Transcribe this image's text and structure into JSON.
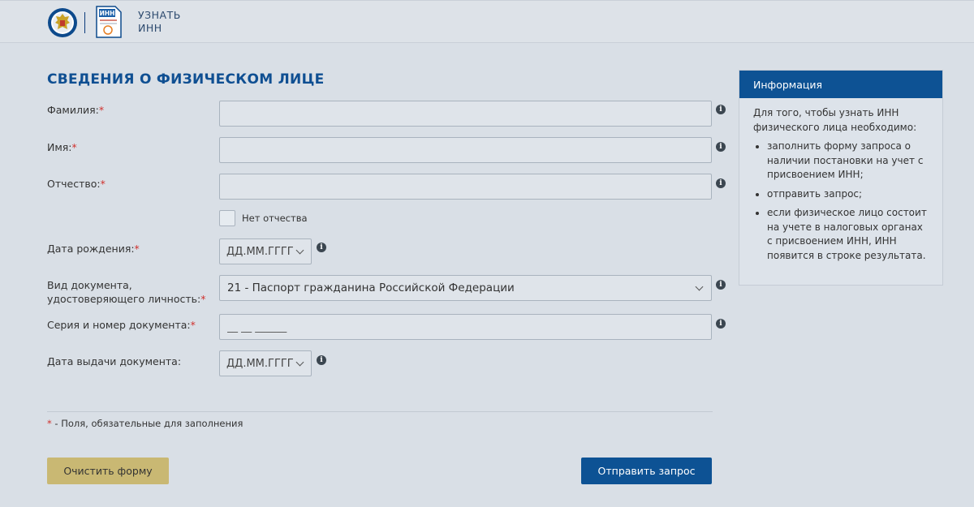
{
  "header": {
    "inn_icon_text": "ИНН",
    "title_line1": "УЗНАТЬ",
    "title_line2": "ИНН"
  },
  "form": {
    "title": "СВЕДЕНИЯ О ФИЗИЧЕСКОМ ЛИЦЕ",
    "required_mark": "*",
    "surname_label": "Фамилия:",
    "name_label": "Имя:",
    "patronymic_label": "Отчество:",
    "no_patronymic_label": "Нет отчества",
    "birth_date_label": "Дата рождения:",
    "birth_date_placeholder": "ДД.ММ.ГГГГ",
    "doc_type_label_line1": "Вид документа,",
    "doc_type_label_line2": "удостоверяющего личность:",
    "doc_type_value": "21 - Паспорт гражданина Российской Федерации",
    "doc_number_label": "Серия и номер документа:",
    "doc_number_placeholder": "__ __ ______",
    "issue_date_label": "Дата выдачи документа:",
    "issue_date_placeholder": "ДД.ММ.ГГГГ",
    "info_glyph": "i",
    "required_note": "- Поля, обязательные для заполнения",
    "clear_button": "Очистить форму",
    "submit_button": "Отправить запрос"
  },
  "info_panel": {
    "heading": "Информация",
    "intro": "Для того, чтобы узнать ИНН физического лица необходимо:",
    "items": [
      "заполнить форму запроса о наличии постановки на учет с присвоением ИНН;",
      "отправить запрос;",
      "если физическое лицо состоит на учете в налоговых органах с присвоением ИНН, ИНН появится в строке результата."
    ]
  },
  "colors": {
    "accent_blue": "#0d5294",
    "title_blue": "#0f4f92",
    "clear_button": "#c9b873",
    "required_red": "#d0312d",
    "background": "#d9dfe6"
  },
  "icons": [
    "emblem-logo-icon",
    "inn-document-icon",
    "info-icon",
    "chevron-down-icon"
  ]
}
